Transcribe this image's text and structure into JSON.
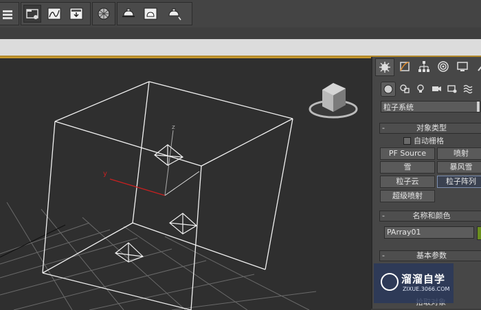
{
  "toolbar": {
    "buttons": [
      "layer-explorer-icon",
      "schematic-view-icon",
      "curve-editor-icon",
      "track-view-icon",
      "material-editor-icon",
      "render-setup-icon",
      "rendered-frame-icon",
      "render-production-icon"
    ]
  },
  "command_panel": {
    "tabs": [
      "create-tab",
      "modify-tab",
      "hierarchy-tab",
      "motion-tab",
      "display-tab",
      "utilities-tab"
    ],
    "subtabs": [
      "geometry",
      "shapes",
      "lights",
      "cameras",
      "helpers",
      "space-warps"
    ],
    "category_dropdown": "粒子系统",
    "object_type": {
      "title": "对象类型",
      "minus": "-",
      "autogrid_label": "自动栅格",
      "buttons": [
        "PF Source",
        "喷射",
        "雪",
        "暴风雪",
        "粒子云",
        "粒子阵列",
        "超级喷射"
      ],
      "selected": "粒子阵列"
    },
    "name_color": {
      "title": "名称和颜色",
      "minus": "-",
      "name_value": "PArray01",
      "color": "#6b8f1f"
    },
    "basic_params": {
      "title": "基本参数",
      "minus": "-",
      "pick_object_label": "拾取对象"
    }
  },
  "viewport": {
    "axis_labels": {
      "z": "z",
      "y": "y"
    }
  },
  "watermark": {
    "title": "溜溜自学",
    "url": "ZIXUE.3066.COM"
  }
}
